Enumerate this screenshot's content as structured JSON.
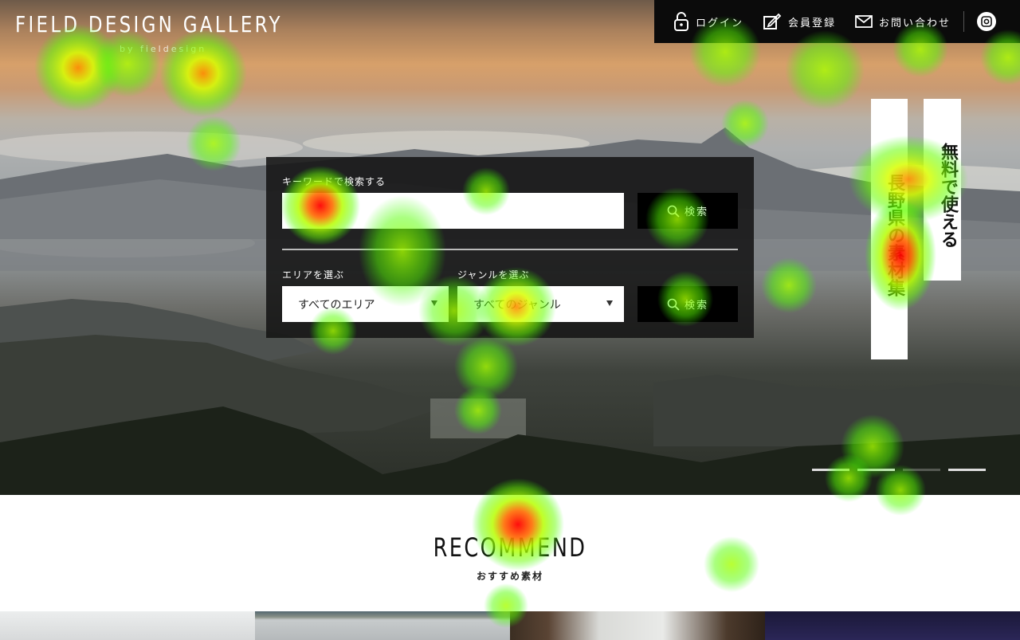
{
  "site": {
    "logo": "FIELD DESIGN GALLERY",
    "logo_sub": "by fieldesign"
  },
  "nav": {
    "login": "ログイン",
    "register": "会員登録",
    "contact": "お問い合わせ"
  },
  "search": {
    "keyword_label": "キーワードで検索する",
    "keyword_placeholder": "",
    "search_button": "検索",
    "area_label": "エリアを選ぶ",
    "area_value": "すべてのエリア",
    "genre_label": "ジャンルを選ぶ",
    "genre_value": "すべてのジャンル",
    "search_button_2": "検索"
  },
  "taglines": {
    "left": "長野県の素材集",
    "right": "無料で使える"
  },
  "recommend": {
    "title": "RECOMMEND",
    "subtitle": "おすすめ素材"
  },
  "colors": {
    "nav_bg": "#0b0b0b",
    "panel_bg": "#141414",
    "accent_white": "#ffffff"
  }
}
